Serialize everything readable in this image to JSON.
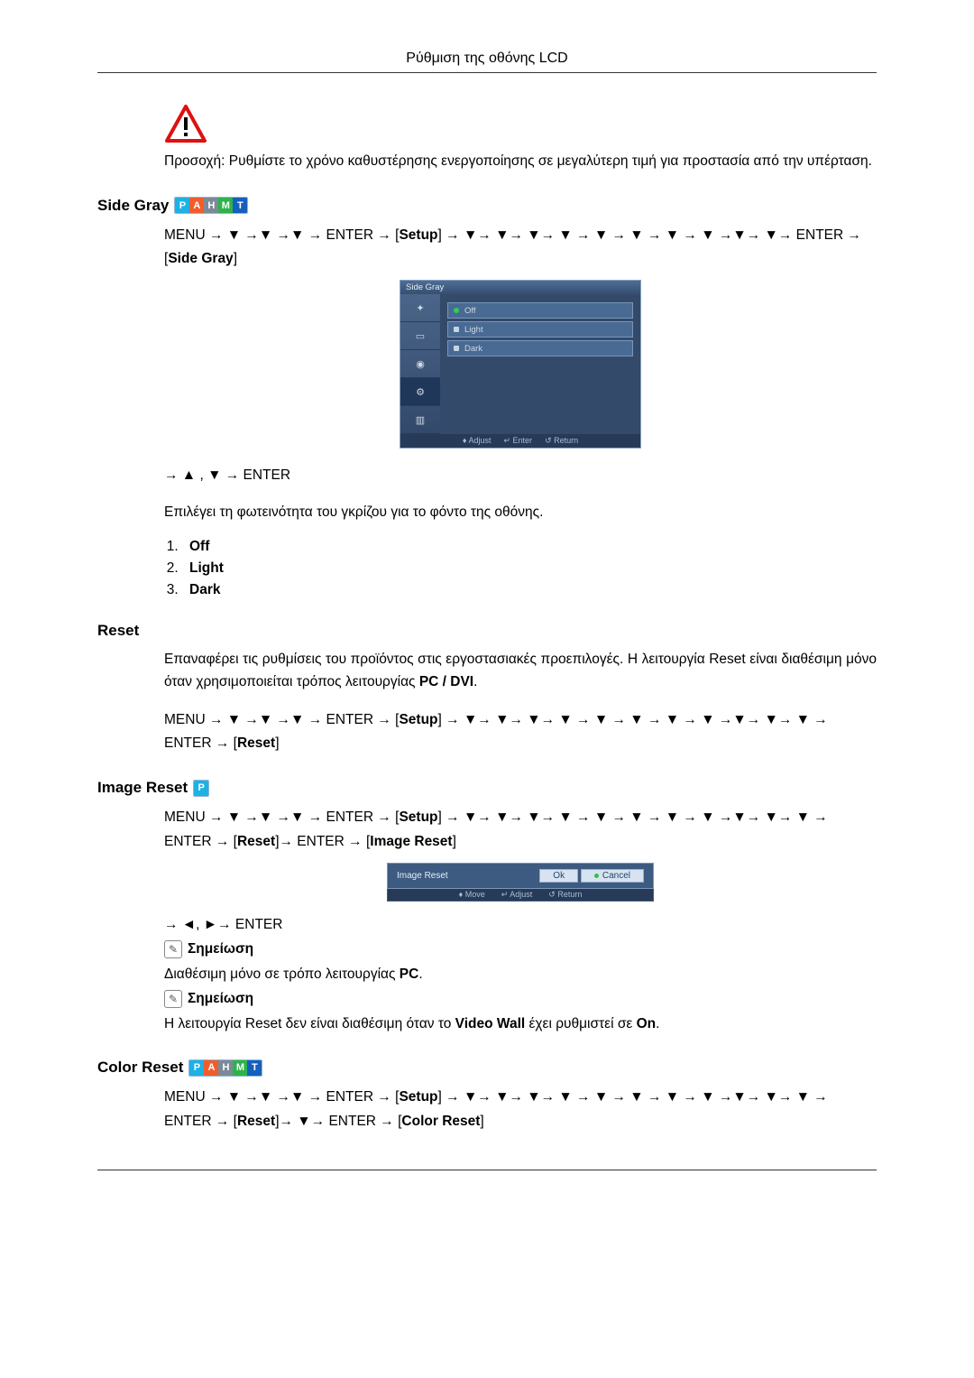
{
  "header": {
    "title": "Ρύθμιση της οθόνης LCD"
  },
  "caution": {
    "text": "Προσοχή: Ρυθμίστε το χρόνο καθυστέρησης ενεργοποίησης σε μεγαλύτερη τιμή για προστασία από την υπέρταση."
  },
  "sections": {
    "side_gray": {
      "title": "Side Gray",
      "tags": [
        "P",
        "A",
        "H",
        "M",
        "T"
      ],
      "menu_path_1": "MENU → ▼ →▼ →▼ → ENTER → ",
      "menu_path_1_br": "Setup",
      "menu_path_1b": " → ▼→ ▼→ ▼→ ▼ → ▼ → ▼ → ▼ → ▼ →▼→ ▼→ ENTER → ",
      "menu_path_1_br2": "Side Gray",
      "osd": {
        "title": "Side Gray",
        "options": [
          "Off",
          "Light",
          "Dark"
        ],
        "footer": [
          "♦ Adjust",
          "↵ Enter",
          "↺ Return"
        ]
      },
      "post_nav": "→ ▲ , ▼ → ENTER",
      "desc": "Επιλέγει τη φωτεινότητα του γκρίζου για το φόντο της οθόνης.",
      "list": [
        "Off",
        "Light",
        "Dark"
      ]
    },
    "reset": {
      "title": "Reset",
      "desc": "Επαναφέρει τις ρυθμίσεις του προϊόντος στις εργοστασιακές προεπιλογές. Η λειτουργία Reset είναι διαθέσιμη μόνο όταν χρησιμοποιείται τρόπος λειτουργίας ",
      "desc_bold": "PC / DVI",
      "menu_path_1": "MENU → ▼ →▼ →▼ → ENTER → ",
      "menu_path_1_br": "Setup",
      "menu_path_1b": " → ▼→ ▼→ ▼→ ▼ → ▼ → ▼ → ▼ → ▼ →▼→ ▼→ ▼ → ENTER → ",
      "menu_path_1_br2": "Reset"
    },
    "image_reset": {
      "title": "Image Reset",
      "tags": [
        "P"
      ],
      "menu_path_1": "MENU → ▼ →▼ →▼ → ENTER → ",
      "menu_path_1_br": "Setup",
      "menu_path_1b": " → ▼→ ▼→ ▼→ ▼ → ▼ → ▼ → ▼ → ▼ →▼→ ▼→ ▼ → ENTER → ",
      "menu_path_1_br2": "Reset",
      "menu_path_1c": "→ ENTER → ",
      "menu_path_1_br3": "Image Reset",
      "dialog": {
        "title": "Image Reset",
        "ok": "Ok",
        "cancel": "Cancel",
        "footer": [
          "♦ Move",
          "↵ Adjust",
          "↺ Return"
        ]
      },
      "post_nav": "→ ◄, ►→ ENTER",
      "note_label": "Σημείωση",
      "note1_pre": "Διαθέσιμη μόνο σε τρόπο λειτουργίας ",
      "note1_bold": "PC",
      "note2_pre": "Η λειτουργία Reset δεν είναι διαθέσιμη όταν το ",
      "note2_mid_bold": "Video Wall",
      "note2_mid": " έχει ρυθμιστεί σε ",
      "note2_end_bold": "On"
    },
    "color_reset": {
      "title": "Color Reset",
      "tags": [
        "P",
        "A",
        "H",
        "M",
        "T"
      ],
      "menu_path_1": "MENU → ▼ →▼ →▼ → ENTER → ",
      "menu_path_1_br": "Setup",
      "menu_path_1b": " → ▼→ ▼→ ▼→ ▼ → ▼ → ▼ → ▼ → ▼ →▼→ ▼→ ▼ → ENTER → ",
      "menu_path_1_br2": "Reset",
      "menu_path_1c": "→ ▼→ ENTER → ",
      "menu_path_1_br3": "Color Reset"
    }
  }
}
